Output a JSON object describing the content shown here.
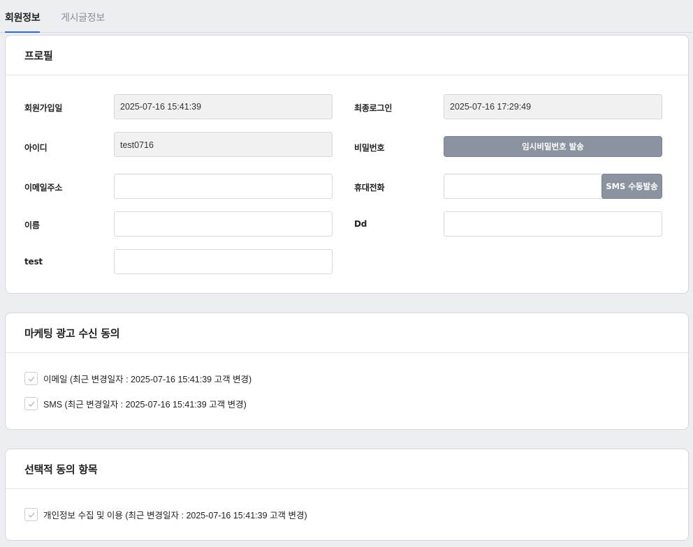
{
  "tabs": [
    {
      "label": "회원정보",
      "active": true
    },
    {
      "label": "게시글정보",
      "active": false
    }
  ],
  "profile": {
    "title": "프로필",
    "join_date_label": "회원가입일",
    "join_date_value": "2025-07-16 15:41:39",
    "last_login_label": "최종로그인",
    "last_login_value": "2025-07-16 17:29:49",
    "id_label": "아이디",
    "id_value": "test0716",
    "password_label": "비밀번호",
    "temp_password_button": "임시비밀번호 발송",
    "email_label": "이메일주소",
    "email_value": "",
    "phone_label": "휴대전화",
    "phone_value": "",
    "sms_button": "SMS 수동발송",
    "name_label": "이름",
    "name_value": "",
    "dd_label": "Dd",
    "dd_value": "",
    "test_label": "test",
    "test_value": ""
  },
  "marketing": {
    "title": "마케팅 광고 수신 동의",
    "items": [
      {
        "label": "이메일 (최근 변경일자 : 2025-07-16 15:41:39 고객 변경)",
        "checked": true
      },
      {
        "label": "SMS (최근 변경일자 : 2025-07-16 15:41:39 고객 변경)",
        "checked": true
      }
    ]
  },
  "optional": {
    "title": "선택적 동의 항목",
    "items": [
      {
        "label": "개인정보 수집 및 이용 (최근 변경일자 : 2025-07-16 15:41:39 고객 변경)",
        "checked": true
      }
    ]
  },
  "colors": {
    "accent": "#2a6ad8",
    "button_gray": "#8a939f",
    "page_bg": "#eceef2"
  }
}
